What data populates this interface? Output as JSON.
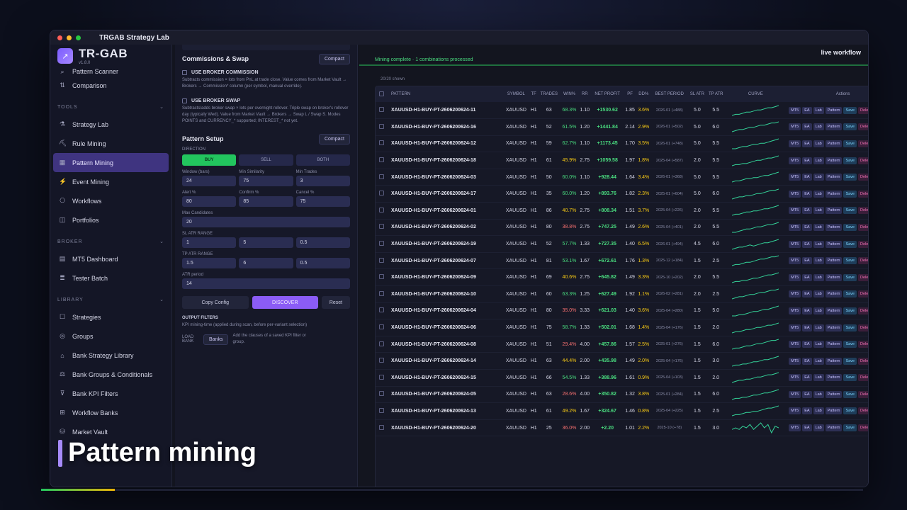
{
  "window": {
    "title": "TRGAB Strategy Lab"
  },
  "app": {
    "name": "TR-GAB",
    "version": "v1.8.0"
  },
  "sidebar": {
    "top_items": [
      {
        "label": "Pattern Scanner",
        "icon": "scanner-icon"
      },
      {
        "label": "Comparison",
        "icon": "compare-icon"
      }
    ],
    "sections": [
      {
        "title": "TOOLS",
        "items": [
          {
            "label": "Strategy Lab",
            "icon": "flask-icon"
          },
          {
            "label": "Rule Mining",
            "icon": "pickaxe-icon"
          },
          {
            "label": "Pattern Mining",
            "icon": "pattern-icon",
            "active": true
          },
          {
            "label": "Event Mining",
            "icon": "event-icon"
          },
          {
            "label": "Workflows",
            "icon": "workflow-icon"
          },
          {
            "label": "Portfolios",
            "icon": "portfolio-icon"
          }
        ]
      },
      {
        "title": "BROKER",
        "items": [
          {
            "label": "MT5 Dashboard",
            "icon": "dashboard-icon"
          },
          {
            "label": "Tester Batch",
            "icon": "batch-icon"
          }
        ]
      },
      {
        "title": "LIBRARY",
        "items": [
          {
            "label": "Strategies",
            "icon": "strategy-icon"
          },
          {
            "label": "Groups",
            "icon": "groups-icon"
          },
          {
            "label": "Bank Strategy Library",
            "icon": "bank-icon"
          },
          {
            "label": "Bank Groups & Conditionals",
            "icon": "bank-groups-icon"
          },
          {
            "label": "Bank KPI Filters",
            "icon": "filter-icon"
          },
          {
            "label": "Workflow Banks",
            "icon": "workflow-bank-icon"
          },
          {
            "label": "Market Vault",
            "icon": "vault-icon"
          }
        ]
      }
    ]
  },
  "config": {
    "commissions": {
      "title": "Commissions & Swap",
      "compact": "Compact",
      "broker_commission": "USE BROKER COMMISSION",
      "broker_commission_desc": "Subtracts commission × lots from PnL at trade close. Value comes from Market Vault → Brokers → Commission* column (per symbol, manual override).",
      "broker_swap": "USE BROKER SWAP",
      "broker_swap_desc": "Subtracts/adds broker swap × lots per overnight rollover. Triple swap on broker's rollover day (typically Wed). Value from Market Vault → Brokers → Swap L / Swap S. Modes POINTS and CURRENCY_* supported; INTEREST_* not yet."
    },
    "pattern": {
      "title": "Pattern Setup",
      "compact": "Compact",
      "direction_label": "DIRECTION",
      "directions": [
        "BUY",
        "SELL",
        "BOTH"
      ],
      "window_label": "Window (bars)",
      "window": "24",
      "minsim_label": "Min Similarity",
      "minsim": "75",
      "mintrades_label": "Min Trades",
      "mintrades": "3",
      "alert_label": "Alert %",
      "alert": "80",
      "confirm_label": "Confirm %",
      "confirm": "85",
      "cancel_label": "Cancel %",
      "cancel": "75",
      "maxcand_label": "Max Candidates",
      "maxcand": "20",
      "slatr_label": "SL ATR RANGE",
      "slatr": [
        "1",
        "5",
        "0.5"
      ],
      "tpatr_label": "TP ATR RANGE",
      "tpatr": [
        "1.5",
        "6",
        "0.5"
      ],
      "atr_label": "ATR period",
      "atr": "14",
      "copy": "Copy Config",
      "discover": "DISCOVER",
      "reset": "Reset"
    },
    "output": {
      "title": "OUTPUT FILTERS",
      "desc": "KPI mining-time (applied during scan, before per-variant selection)",
      "load_bank": "LOAD BANK",
      "banks": "Banks",
      "add_desc": "Add the clauses of a saved KPI filter or group."
    }
  },
  "main": {
    "live_workflow": "live workflow",
    "status": "Mining complete · 1 combinations processed",
    "count": "20/20 shown",
    "columns": [
      "PATTERN",
      "SYMBOL",
      "TF",
      "TRADES",
      "WIN%",
      "RR",
      "NET PROFIT",
      "PF",
      "DD%",
      "BEST PERIOD",
      "SL ATR",
      "TP ATR",
      "CURVE",
      "Actions"
    ],
    "action_labels": [
      "MT5",
      "EA",
      "Lab",
      "Pattern",
      "Save",
      "Delete"
    ],
    "rows": [
      {
        "pattern": "XAUUSD-H1-BUY-PT-2606200624-11",
        "symbol": "XAUUSD",
        "tf": "H1",
        "trades": "63",
        "win": "68.3%",
        "win_c": "g",
        "rr": "1.10",
        "net": "+1530.62",
        "pf": "1.85",
        "dd": "3.6%",
        "dd_c": "y",
        "period": "2026-01 (+488)",
        "sl": "5.0",
        "tp": "5.5",
        "curve": [
          2,
          3,
          3,
          4,
          5,
          5,
          6,
          7,
          7,
          8,
          9,
          9,
          10,
          11
        ]
      },
      {
        "pattern": "XAUUSD-H1-BUY-PT-2606200624-16",
        "symbol": "XAUUSD",
        "tf": "H1",
        "trades": "52",
        "win": "61.5%",
        "win_c": "g",
        "rr": "1.20",
        "net": "+1441.84",
        "pf": "2.14",
        "dd": "2.9%",
        "dd_c": "y",
        "period": "2026-01 (+502)",
        "sl": "5.0",
        "tp": "6.0",
        "curve": [
          2,
          3,
          4,
          4,
          5,
          6,
          6,
          7,
          8,
          8,
          9,
          10,
          10,
          11
        ]
      },
      {
        "pattern": "XAUUSD-H1-BUY-PT-2606200624-12",
        "symbol": "XAUUSD",
        "tf": "H1",
        "trades": "59",
        "win": "62.7%",
        "win_c": "g",
        "rr": "1.10",
        "net": "+1173.45",
        "pf": "1.70",
        "dd": "3.5%",
        "dd_c": "y",
        "period": "2026-01 (+748)",
        "sl": "5.0",
        "tp": "5.5",
        "curve": [
          2,
          2,
          3,
          4,
          4,
          5,
          6,
          6,
          7,
          7,
          8,
          9,
          10,
          11
        ]
      },
      {
        "pattern": "XAUUSD-H1-BUY-PT-2606200624-18",
        "symbol": "XAUUSD",
        "tf": "H1",
        "trades": "61",
        "win": "45.9%",
        "win_c": "y",
        "rr": "2.75",
        "net": "+1059.58",
        "pf": "1.97",
        "dd": "1.8%",
        "dd_c": "y",
        "period": "2025-04 (+587)",
        "sl": "2.0",
        "tp": "5.5",
        "curve": [
          2,
          3,
          3,
          4,
          4,
          5,
          6,
          7,
          7,
          8,
          9,
          9,
          10,
          11
        ]
      },
      {
        "pattern": "XAUUSD-H1-BUY-PT-2606200624-03",
        "symbol": "XAUUSD",
        "tf": "H1",
        "trades": "50",
        "win": "60.0%",
        "win_c": "g",
        "rr": "1.10",
        "net": "+928.44",
        "pf": "1.64",
        "dd": "3.4%",
        "dd_c": "y",
        "period": "2026-01 (+368)",
        "sl": "5.0",
        "tp": "5.5",
        "curve": [
          2,
          3,
          3,
          4,
          5,
          5,
          6,
          6,
          7,
          8,
          8,
          9,
          10,
          11
        ]
      },
      {
        "pattern": "XAUUSD-H1-BUY-PT-2606200624-17",
        "symbol": "XAUUSD",
        "tf": "H1",
        "trades": "35",
        "win": "60.0%",
        "win_c": "g",
        "rr": "1.20",
        "net": "+893.76",
        "pf": "1.82",
        "dd": "2.3%",
        "dd_c": "y",
        "period": "2025-01 (+604)",
        "sl": "5.0",
        "tp": "6.0",
        "curve": [
          2,
          3,
          4,
          4,
          5,
          5,
          6,
          7,
          7,
          8,
          9,
          10,
          10,
          11
        ]
      },
      {
        "pattern": "XAUUSD-H1-BUY-PT-2606200624-01",
        "symbol": "XAUUSD",
        "tf": "H1",
        "trades": "86",
        "win": "40.7%",
        "win_c": "y",
        "rr": "2.75",
        "net": "+808.34",
        "pf": "1.51",
        "dd": "3.7%",
        "dd_c": "y",
        "period": "2025-04 (+226)",
        "sl": "2.0",
        "tp": "5.5",
        "curve": [
          2,
          3,
          3,
          4,
          5,
          5,
          6,
          6,
          7,
          8,
          8,
          9,
          10,
          11
        ]
      },
      {
        "pattern": "XAUUSD-H1-BUY-PT-2606200624-02",
        "symbol": "XAUUSD",
        "tf": "H1",
        "trades": "80",
        "win": "38.8%",
        "win_c": "r",
        "rr": "2.75",
        "net": "+747.25",
        "pf": "1.49",
        "dd": "2.6%",
        "dd_c": "y",
        "period": "2025-04 (+401)",
        "sl": "2.0",
        "tp": "5.5",
        "curve": [
          2,
          2,
          3,
          4,
          5,
          5,
          6,
          7,
          7,
          8,
          9,
          9,
          10,
          11
        ]
      },
      {
        "pattern": "XAUUSD-H1-BUY-PT-2606200624-19",
        "symbol": "XAUUSD",
        "tf": "H1",
        "trades": "52",
        "win": "57.7%",
        "win_c": "g",
        "rr": "1.33",
        "net": "+727.35",
        "pf": "1.40",
        "dd": "6.5%",
        "dd_c": "y",
        "period": "2026-01 (+494)",
        "sl": "4.5",
        "tp": "6.0",
        "curve": [
          2,
          3,
          4,
          4,
          5,
          6,
          5,
          6,
          7,
          8,
          8,
          9,
          10,
          11
        ]
      },
      {
        "pattern": "XAUUSD-H1-BUY-PT-2606200624-07",
        "symbol": "XAUUSD",
        "tf": "H1",
        "trades": "81",
        "win": "53.1%",
        "win_c": "g",
        "rr": "1.67",
        "net": "+672.61",
        "pf": "1.76",
        "dd": "1.3%",
        "dd_c": "y",
        "period": "2025-12 (+184)",
        "sl": "1.5",
        "tp": "2.5",
        "curve": [
          2,
          3,
          3,
          4,
          5,
          5,
          6,
          7,
          8,
          8,
          9,
          10,
          10,
          11
        ]
      },
      {
        "pattern": "XAUUSD-H1-BUY-PT-2606200624-09",
        "symbol": "XAUUSD",
        "tf": "H1",
        "trades": "69",
        "win": "40.6%",
        "win_c": "y",
        "rr": "2.75",
        "net": "+645.82",
        "pf": "1.49",
        "dd": "3.3%",
        "dd_c": "y",
        "period": "2025-10 (+202)",
        "sl": "2.0",
        "tp": "5.5",
        "curve": [
          2,
          3,
          3,
          4,
          4,
          5,
          6,
          6,
          7,
          8,
          9,
          9,
          10,
          11
        ]
      },
      {
        "pattern": "XAUUSD-H1-BUY-PT-2606200624-10",
        "symbol": "XAUUSD",
        "tf": "H1",
        "trades": "60",
        "win": "63.3%",
        "win_c": "g",
        "rr": "1.25",
        "net": "+627.49",
        "pf": "1.92",
        "dd": "1.1%",
        "dd_c": "y",
        "period": "2026-02 (+281)",
        "sl": "2.0",
        "tp": "2.5",
        "curve": [
          2,
          3,
          4,
          4,
          5,
          6,
          6,
          7,
          8,
          8,
          9,
          10,
          10,
          11
        ]
      },
      {
        "pattern": "XAUUSD-H1-BUY-PT-2606200624-04",
        "symbol": "XAUUSD",
        "tf": "H1",
        "trades": "80",
        "win": "35.0%",
        "win_c": "r",
        "rr": "3.33",
        "net": "+621.03",
        "pf": "1.40",
        "dd": "3.6%",
        "dd_c": "y",
        "period": "2025-04 (+280)",
        "sl": "1.5",
        "tp": "5.0",
        "curve": [
          2,
          2,
          3,
          3,
          4,
          5,
          6,
          6,
          7,
          8,
          8,
          9,
          10,
          11
        ]
      },
      {
        "pattern": "XAUUSD-H1-BUY-PT-2606200624-06",
        "symbol": "XAUUSD",
        "tf": "H1",
        "trades": "75",
        "win": "58.7%",
        "win_c": "g",
        "rr": "1.33",
        "net": "+502.01",
        "pf": "1.68",
        "dd": "1.4%",
        "dd_c": "y",
        "period": "2025-04 (+176)",
        "sl": "1.5",
        "tp": "2.0",
        "curve": [
          2,
          3,
          3,
          4,
          5,
          5,
          6,
          7,
          7,
          8,
          9,
          9,
          10,
          11
        ]
      },
      {
        "pattern": "XAUUSD-H1-BUY-PT-2606200624-08",
        "symbol": "XAUUSD",
        "tf": "H1",
        "trades": "51",
        "win": "29.4%",
        "win_c": "r",
        "rr": "4.00",
        "net": "+457.86",
        "pf": "1.57",
        "dd": "2.5%",
        "dd_c": "y",
        "period": "2025-01 (+276)",
        "sl": "1.5",
        "tp": "6.0",
        "curve": [
          2,
          3,
          3,
          4,
          5,
          5,
          6,
          7,
          7,
          8,
          9,
          10,
          10,
          11
        ]
      },
      {
        "pattern": "XAUUSD-H1-BUY-PT-2606200624-14",
        "symbol": "XAUUSD",
        "tf": "H1",
        "trades": "63",
        "win": "44.4%",
        "win_c": "y",
        "rr": "2.00",
        "net": "+435.98",
        "pf": "1.49",
        "dd": "2.0%",
        "dd_c": "y",
        "period": "2025-04 (+176)",
        "sl": "1.5",
        "tp": "3.0",
        "curve": [
          2,
          3,
          3,
          4,
          4,
          5,
          6,
          6,
          7,
          8,
          8,
          9,
          10,
          11
        ]
      },
      {
        "pattern": "XAUUSD-H1-BUY-PT-2606200624-15",
        "symbol": "XAUUSD",
        "tf": "H1",
        "trades": "66",
        "win": "54.5%",
        "win_c": "g",
        "rr": "1.33",
        "net": "+388.96",
        "pf": "1.61",
        "dd": "0.9%",
        "dd_c": "y",
        "period": "2025-04 (+103)",
        "sl": "1.5",
        "tp": "2.0",
        "curve": [
          2,
          3,
          4,
          4,
          5,
          5,
          6,
          7,
          7,
          8,
          9,
          9,
          10,
          11
        ]
      },
      {
        "pattern": "XAUUSD-H1-BUY-PT-2606200624-05",
        "symbol": "XAUUSD",
        "tf": "H1",
        "trades": "63",
        "win": "28.6%",
        "win_c": "r",
        "rr": "4.00",
        "net": "+350.82",
        "pf": "1.32",
        "dd": "3.8%",
        "dd_c": "y",
        "period": "2025-01 (+284)",
        "sl": "1.5",
        "tp": "6.0",
        "curve": [
          2,
          3,
          3,
          4,
          4,
          5,
          6,
          6,
          7,
          8,
          8,
          9,
          10,
          11
        ]
      },
      {
        "pattern": "XAUUSD-H1-BUY-PT-2606200624-13",
        "symbol": "XAUUSD",
        "tf": "H1",
        "trades": "61",
        "win": "49.2%",
        "win_c": "y",
        "rr": "1.67",
        "net": "+324.67",
        "pf": "1.46",
        "dd": "0.8%",
        "dd_c": "y",
        "period": "2025-04 (+225)",
        "sl": "1.5",
        "tp": "2.5",
        "curve": [
          2,
          3,
          3,
          4,
          5,
          5,
          6,
          6,
          7,
          8,
          9,
          9,
          10,
          11
        ]
      },
      {
        "pattern": "XAUUSD-H1-BUY-PT-2606200624-20",
        "symbol": "XAUUSD",
        "tf": "H1",
        "trades": "25",
        "win": "36.0%",
        "win_c": "r",
        "rr": "2.00",
        "net": "+2.20",
        "pf": "1.01",
        "dd": "2.2%",
        "dd_c": "y",
        "period": "2025-10 (+78)",
        "sl": "1.5",
        "tp": "3.0",
        "curve": [
          5,
          6,
          5,
          7,
          6,
          8,
          5,
          7,
          9,
          6,
          8,
          3,
          7,
          6
        ]
      }
    ]
  },
  "caption": {
    "text": "Pattern mining"
  },
  "colors": {
    "accent": "#7b5cff",
    "green": "#22c55e",
    "yellow": "#facc15",
    "red": "#f87171"
  }
}
